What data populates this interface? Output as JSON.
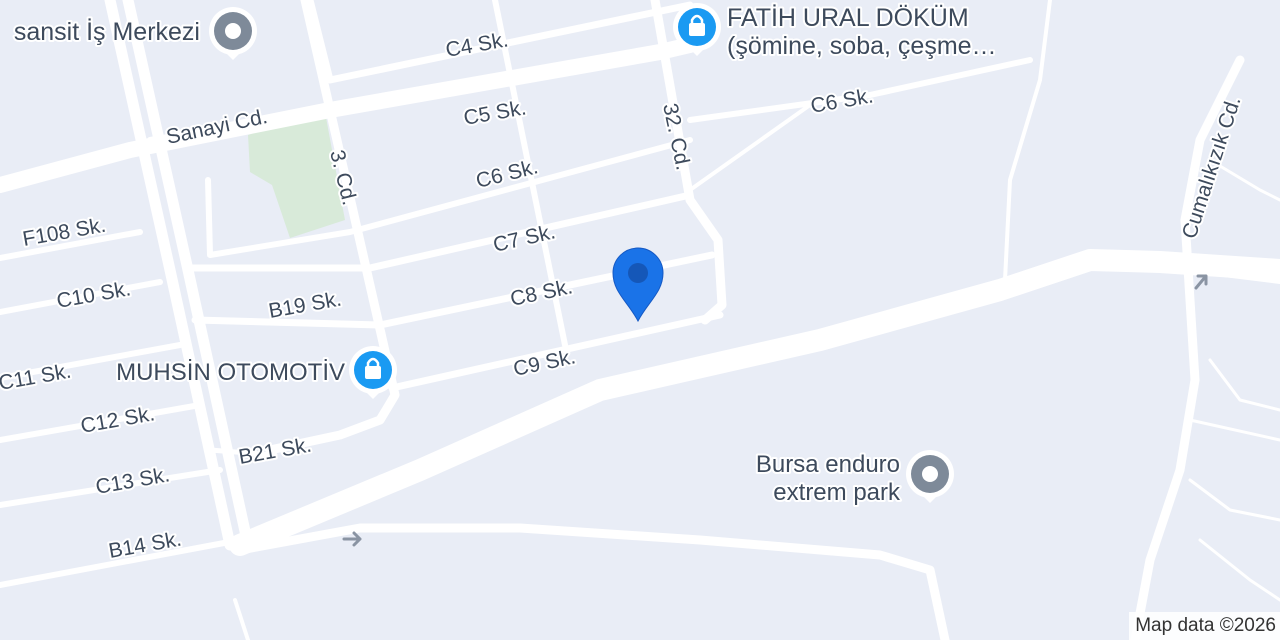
{
  "map": {
    "colors": {
      "land": "#e9edf6",
      "road": "#ffffff",
      "park": "#d8ead9",
      "label": "#3d4a5c",
      "marker": "#1a73e8",
      "shop_poi": "#1a9af2",
      "generic_poi": "#7e8a99"
    },
    "streets": {
      "c4": "C4 Sk.",
      "c5": "C5 Sk.",
      "c6_left": "C6 Sk.",
      "c6_right": "C6 Sk.",
      "c7": "C7 Sk.",
      "c8": "C8 Sk.",
      "c9": "C9 Sk.",
      "c10": "C10 Sk.",
      "c11": "C11 Sk.",
      "c12": "C12 Sk.",
      "c13": "C13 Sk.",
      "b14": "B14 Sk.",
      "b19": "B19 Sk.",
      "b21": "B21 Sk.",
      "f108": "F108 Sk.",
      "sanayi": "Sanayi Cd.",
      "cd3": "3. Cd.",
      "cd32": "32. Cd.",
      "cumalikizik": "Cumalıkızık Cd."
    },
    "pois": {
      "sansit": {
        "label": "sansit İş Merkezi",
        "icon": "generic-place-icon"
      },
      "fatih": {
        "line1": "FATİH URAL DÖKÜM",
        "line2": "(şömine, soba, çeşme…",
        "icon": "shopping-bag-icon"
      },
      "muhsin": {
        "label": "MUHSİN OTOMOTİV",
        "icon": "shopping-bag-icon"
      },
      "bursa": {
        "line1": "Bursa enduro",
        "line2": "extrem park",
        "icon": "generic-place-icon"
      }
    },
    "selected_marker": {
      "icon": "location-pin-icon"
    },
    "attribution": "Map data ©2026"
  }
}
